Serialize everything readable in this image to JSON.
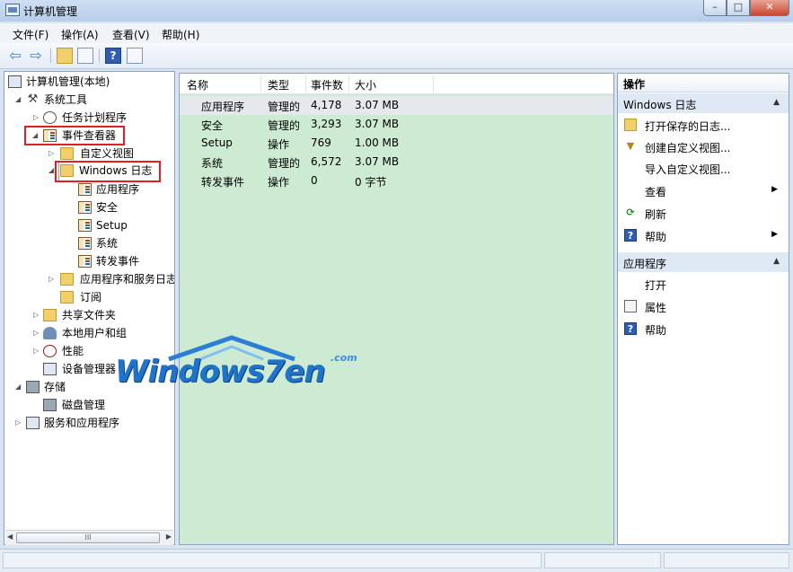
{
  "window": {
    "title": "计算机管理"
  },
  "window_controls": {
    "minimize": "–",
    "maximize": "□",
    "close": "✕"
  },
  "menu": [
    "文件(F)",
    "操作(A)",
    "查看(V)",
    "帮助(H)"
  ],
  "toolbar": {
    "icons": [
      "back-icon",
      "forward-icon",
      "up-folder-icon",
      "show-hide-tree-icon",
      "help-icon",
      "show-action-pane-icon"
    ]
  },
  "tree": {
    "root": "计算机管理(本地)",
    "system_tools": "系统工具",
    "task_scheduler": "任务计划程序",
    "event_viewer": "事件查看器",
    "custom_views": "自定义视图",
    "windows_logs": "Windows 日志",
    "log_application": "应用程序",
    "log_security": "安全",
    "log_setup": "Setup",
    "log_system": "系统",
    "log_forwarded": "转发事件",
    "app_service_logs": "应用程序和服务日志",
    "subscriptions": "订阅",
    "shared_folders": "共享文件夹",
    "local_users_groups": "本地用户和组",
    "performance": "性能",
    "device_manager": "设备管理器",
    "storage": "存储",
    "disk_management": "磁盘管理",
    "services_apps": "服务和应用程序"
  },
  "scrollbar": {
    "thumb": "III"
  },
  "list": {
    "columns": [
      "名称",
      "类型",
      "事件数",
      "大小"
    ],
    "rows": [
      {
        "name": "应用程序",
        "type": "管理的",
        "count": "4,178",
        "size": "3.07 MB"
      },
      {
        "name": "安全",
        "type": "管理的",
        "count": "3,293",
        "size": "3.07 MB"
      },
      {
        "name": "Setup",
        "type": "操作",
        "count": "769",
        "size": "1.00 MB"
      },
      {
        "name": "系统",
        "type": "管理的",
        "count": "6,572",
        "size": "3.07 MB"
      },
      {
        "name": "转发事件",
        "type": "操作",
        "count": "0",
        "size": "0 字节"
      }
    ]
  },
  "actions": {
    "header": "操作",
    "section1": "Windows 日志",
    "open_saved_log": "打开保存的日志...",
    "create_custom_view": "创建自定义视图...",
    "import_custom_view": "导入自定义视图...",
    "view": "查看",
    "refresh": "刷新",
    "help": "帮助",
    "section2": "应用程序",
    "open": "打开",
    "properties": "属性",
    "help2": "帮助"
  },
  "watermark": {
    "main": "Windows7en",
    "domain": ".com"
  }
}
